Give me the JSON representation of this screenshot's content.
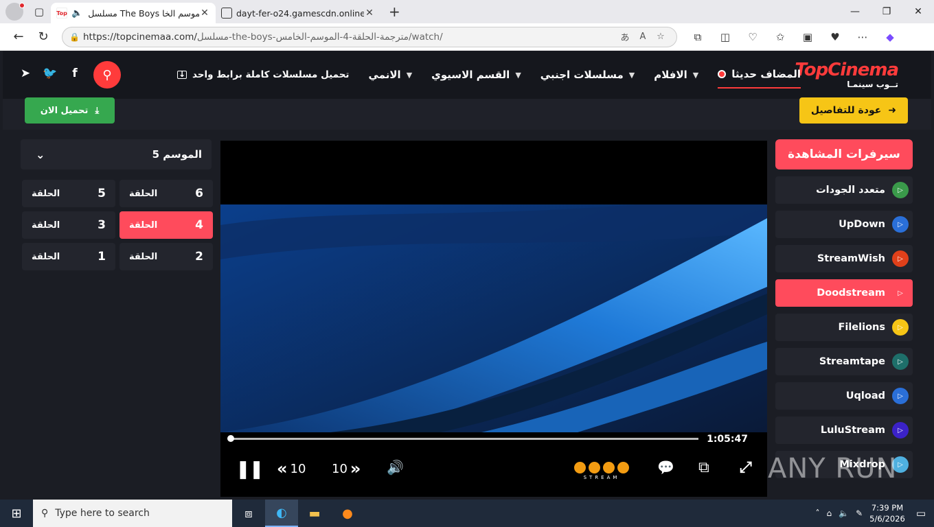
{
  "browser": {
    "tabs": [
      {
        "title": "مسلسل The Boys الموسم الخا",
        "favicon": "Top"
      },
      {
        "title": "dayt-fer-o24.gamescdn.online"
      }
    ],
    "url_host": "https://topcinemaa.com/",
    "url_path": "مسلسل-the-boys-مترجمة-الحلقة-4-الموسم-الخامس/watch/"
  },
  "site": {
    "logo_top": "TopCinema",
    "logo_bottom": "تــوب سينمـا",
    "nav": [
      {
        "label": "المضاف حديثا",
        "active": true,
        "dot": true
      },
      {
        "label": "الافلام",
        "chevron": true
      },
      {
        "label": "مسلسلات اجنبي",
        "chevron": true
      },
      {
        "label": "القسم الاسيوي",
        "chevron": true
      },
      {
        "label": "الانمي",
        "chevron": true
      },
      {
        "label": "تحميل مسلسلات كاملة برابط واحد",
        "download": true
      }
    ],
    "back_label": "عودة للتفاصيل",
    "download_label": "تحميل الان"
  },
  "servers": {
    "title": "سيرفرات المشاهدة",
    "items": [
      {
        "label": "متعدد الجودات",
        "icon_color": "#3a9a4a"
      },
      {
        "label": "UpDown",
        "icon_color": "#2a6fd8"
      },
      {
        "label": "StreamWish",
        "icon_color": "#e0401a"
      },
      {
        "label": "Doodstream",
        "icon_color": "#ff4b5c",
        "active": true
      },
      {
        "label": "Filelions",
        "icon_color": "#f6c516"
      },
      {
        "label": "Streamtape",
        "icon_color": "#1e6f6a"
      },
      {
        "label": "Uqload",
        "icon_color": "#2a6fd8"
      },
      {
        "label": "LuluStream",
        "icon_color": "#3b22c8"
      },
      {
        "label": "Mixdrop",
        "icon_color": "#4fb0e0"
      }
    ]
  },
  "player": {
    "time": "1:05:47",
    "progress": 0.0,
    "rewind": "10",
    "forward": "10",
    "brand_word": "STREAM"
  },
  "season": {
    "label": "الموسم 5",
    "episode_word": "الحلقة",
    "episodes": [
      6,
      5,
      4,
      3,
      2,
      1
    ],
    "active_episode": 4
  },
  "watermark": "ANY RUN",
  "taskbar": {
    "search_placeholder": "Type here to search",
    "time": "7:39 PM",
    "date": "5/6/2026"
  }
}
